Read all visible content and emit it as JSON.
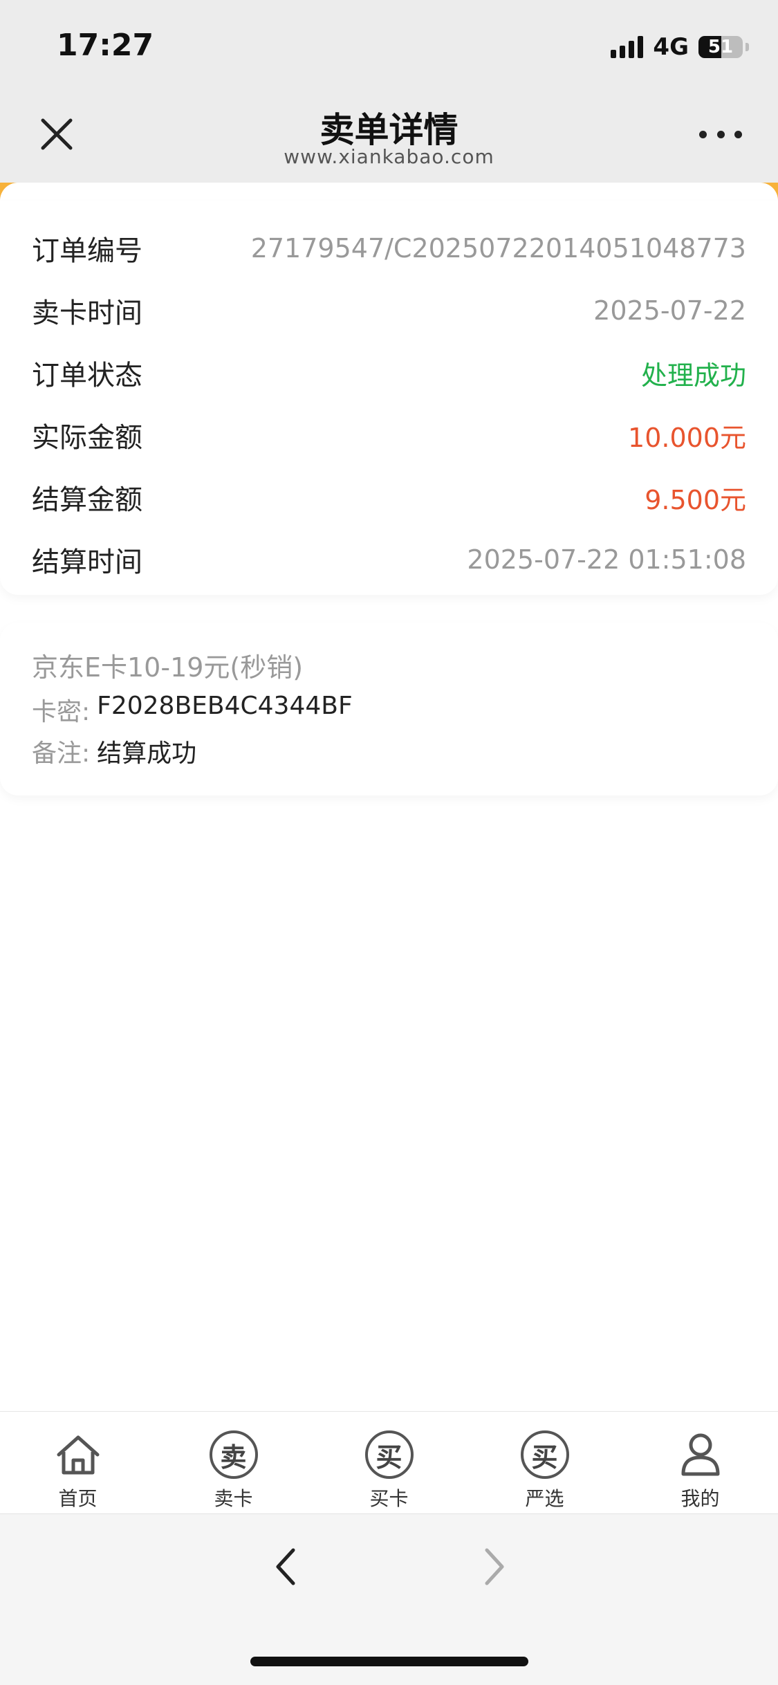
{
  "status_bar": {
    "time": "17:27",
    "network": "4G",
    "battery": "51",
    "battery_level": 0.51
  },
  "header": {
    "title": "卖单详情",
    "url": "www.xiankabao.com",
    "close_icon": "close-icon",
    "more_icon": "more-icon"
  },
  "order": {
    "rows": [
      {
        "label": "订单编号",
        "value": "27179547/C2025072201405104877 73"
      },
      {
        "label": "卖卡时间",
        "value": "2025-07-22"
      },
      {
        "label": "订单状态",
        "value": "处理成功"
      },
      {
        "label": "实际金额",
        "value": "10.000元"
      },
      {
        "label": "结算金额",
        "value": "9.500元"
      },
      {
        "label": "结算时间",
        "value": "2025-07-22 01:51:08"
      }
    ]
  },
  "card_detail": {
    "title": "京东E卡10-19元(秒销)",
    "secret_label": "卡密:",
    "secret_value": "F2028BEB4C4344BF",
    "note_label": "备注:",
    "note_value": "结算成功"
  },
  "tabbar": {
    "items": [
      {
        "label": "首页",
        "icon": "home-icon"
      },
      {
        "label": "卖卡",
        "icon": "sell-icon",
        "glyph": "卖"
      },
      {
        "label": "买卡",
        "icon": "buy-icon",
        "glyph": "买"
      },
      {
        "label": "严选",
        "icon": "select-icon",
        "glyph": "买"
      },
      {
        "label": "我的",
        "icon": "user-icon"
      }
    ]
  },
  "colors": {
    "accent": "#f7b23b",
    "success": "#22b14c",
    "amount": "#e8542e",
    "muted": "#999999"
  }
}
